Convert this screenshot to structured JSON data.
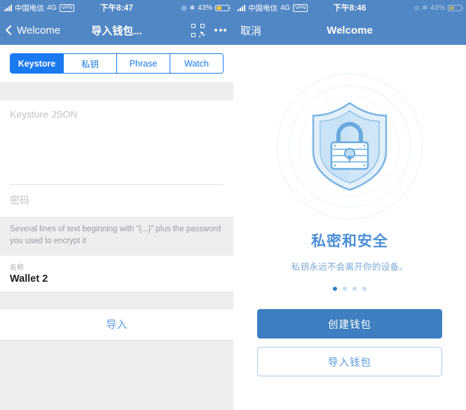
{
  "left": {
    "status_bar": {
      "carrier": "中国电信",
      "network": "4G",
      "vpn": "VPN",
      "time": "下午8:47",
      "battery_percent": "43%",
      "location_icon": "location-icon",
      "bluetooth_icon": "bluetooth-icon",
      "battery_color": "#f5c542"
    },
    "nav": {
      "back_label": "Welcome",
      "title": "导入钱包...",
      "scan_icon": "qr-scan-icon",
      "more_icon": "more-dots-icon"
    },
    "tabs": [
      {
        "label": "Keystore",
        "active": true
      },
      {
        "label": "私钥",
        "active": false
      },
      {
        "label": "Phrase",
        "active": false
      },
      {
        "label": "Watch",
        "active": false
      }
    ],
    "form": {
      "keystore_placeholder": "Keystore JSON",
      "keystore_value": "",
      "password_placeholder": "密码",
      "password_value": "",
      "hint": "Several lines of text beginning with “{...}” plus the password you used to encrypt it",
      "name_label": "名称",
      "name_value": "Wallet 2",
      "submit_label": "导入"
    },
    "colors": {
      "nav_blue": "#5287c6",
      "tab_blue": "#1a7af0",
      "link_blue": "#5e9aea",
      "page_bg": "#edeef0"
    }
  },
  "right": {
    "status_bar": {
      "carrier": "中国电信",
      "network": "4G",
      "vpn": "VPN",
      "time": "下午8:46",
      "battery_percent": "43%",
      "location_icon": "location-icon",
      "bluetooth_icon": "bluetooth-icon",
      "battery_color": "#f5c542"
    },
    "nav": {
      "cancel_label": "取消",
      "title": "Welcome"
    },
    "hero": {
      "illustration": "shield-lock-icon",
      "title": "私密和安全",
      "subtitle": "私钥永远不会离开你的设备。"
    },
    "pager": {
      "total": 4,
      "active_index": 0
    },
    "actions": {
      "primary_label": "创建钱包",
      "secondary_label": "导入钱包"
    },
    "colors": {
      "title_blue": "#4b8fd6",
      "subtitle_blue": "#7ea9d8",
      "primary_btn": "#3d7fc0",
      "secondary_border": "#a9cdf0"
    }
  }
}
